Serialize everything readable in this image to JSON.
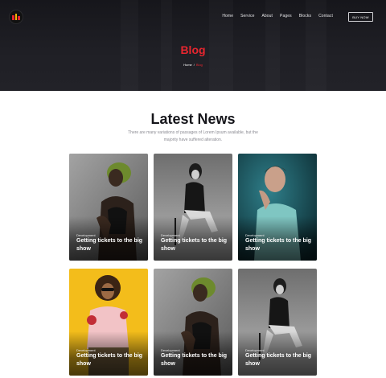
{
  "header": {
    "logo": "logo-icon",
    "nav": [
      "Home",
      "Service",
      "About",
      "Pages",
      "Blocks",
      "Contact"
    ],
    "buy_button": "BUY NOW",
    "title": "Blog",
    "breadcrumb": {
      "home": "Home",
      "separator": "/",
      "current": "Blog"
    }
  },
  "news": {
    "title": "Latest News",
    "subtitle": "There are many variations of passages of Lorem Ipsum available, but the majority have suffered alteration.",
    "cards": [
      {
        "category": "Development",
        "title": "Getting tickets to the big show",
        "image": "woman-head-wrap-photo"
      },
      {
        "category": "Development",
        "title": "Getting tickets to the big show",
        "image": "woman-sitting-chair-photo"
      },
      {
        "category": "Development",
        "title": "Getting tickets to the big show",
        "image": "man-portrait-teal-photo"
      },
      {
        "category": "Development",
        "title": "Getting tickets to the big show",
        "image": "woman-sunglasses-yellow-photo"
      },
      {
        "category": "Development",
        "title": "Getting tickets to the big show",
        "image": "woman-head-wrap-photo"
      },
      {
        "category": "Development",
        "title": "Getting tickets to the big show",
        "image": "woman-sitting-chair-photo"
      }
    ]
  },
  "colors": {
    "accent": "#e8262f",
    "hero_bg": "#1c1c21",
    "heading": "#16161b"
  }
}
